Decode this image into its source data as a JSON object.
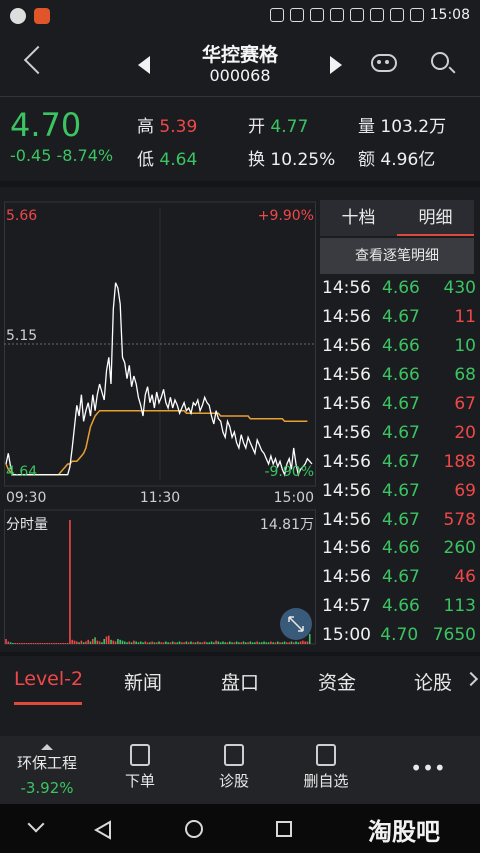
{
  "status_bar": {
    "time": "15:08"
  },
  "header": {
    "title": "华控赛格",
    "code": "000068"
  },
  "quote": {
    "price": "4.70",
    "change": "-0.45",
    "change_pct": "-8.74%",
    "high_label": "高",
    "high": "5.39",
    "low_label": "低",
    "low": "4.64",
    "open_label": "开",
    "open": "4.77",
    "turnover_label": "换",
    "turnover": "10.25%",
    "volume_label": "量",
    "volume": "103.2万",
    "amount_label": "额",
    "amount": "4.96亿"
  },
  "chart_data": {
    "type": "line",
    "y_top_label": "5.66",
    "y_mid_label": "5.15",
    "y_bottom_label": "4.64",
    "pct_top_label": "+9.90%",
    "pct_bottom_label": "-9.90%",
    "x_labels": [
      "09:30",
      "11:30",
      "15:00"
    ],
    "volume_label": "分时量",
    "volume_max_label": "14.81万",
    "ylim": [
      4.64,
      5.66
    ],
    "price_series": [
      4.7,
      4.74,
      4.69,
      4.66,
      4.66,
      4.66,
      4.66,
      4.66,
      4.66,
      4.66,
      4.66,
      4.66,
      4.66,
      4.66,
      4.66,
      4.66,
      4.66,
      4.66,
      4.66,
      4.66,
      4.66,
      4.66,
      4.66,
      4.66,
      4.66,
      4.66,
      4.66,
      4.66,
      4.69,
      4.76,
      4.84,
      4.92,
      4.88,
      4.96,
      4.86,
      4.9,
      4.93,
      4.88,
      4.96,
      4.9,
      4.96,
      5.0,
      4.97,
      4.94,
      5.05,
      5.1,
      5.0,
      5.28,
      5.38,
      5.36,
      5.3,
      5.1,
      5.08,
      5.02,
      5.07,
      4.99,
      5.03,
      5.0,
      4.95,
      4.92,
      4.88,
      4.96,
      4.99,
      4.93,
      4.96,
      4.91,
      4.97,
      4.93,
      4.95,
      4.98,
      4.93,
      4.91,
      4.95,
      4.91,
      4.94,
      4.92,
      4.89,
      4.91,
      4.93,
      4.9,
      4.91,
      4.89,
      4.93,
      4.92,
      4.94,
      4.9,
      4.92,
      4.95,
      4.93,
      4.92,
      4.88,
      4.85,
      4.9,
      4.87,
      4.86,
      4.82,
      4.8,
      4.86,
      4.84,
      4.8,
      4.82,
      4.78,
      4.76,
      4.81,
      4.78,
      4.76,
      4.8,
      4.78,
      4.76,
      4.74,
      4.79,
      4.77,
      4.75,
      4.74,
      4.72,
      4.7,
      4.73,
      4.7,
      4.72,
      4.69,
      4.71,
      4.68,
      4.66,
      4.7,
      4.72,
      4.68,
      4.76,
      4.7,
      4.66,
      4.68,
      4.69,
      4.7,
      4.72,
      4.71,
      4.7
    ],
    "avg_series": [
      4.7,
      4.68,
      4.67,
      4.66,
      4.66,
      4.66,
      4.66,
      4.66,
      4.66,
      4.66,
      4.66,
      4.66,
      4.66,
      4.66,
      4.66,
      4.66,
      4.66,
      4.66,
      4.66,
      4.66,
      4.66,
      4.66,
      4.66,
      4.66,
      4.67,
      4.68,
      4.69,
      4.7,
      4.7,
      4.71,
      4.71,
      4.71,
      4.72,
      4.73,
      4.74,
      4.76,
      4.8,
      4.84,
      4.86,
      4.88,
      4.89,
      4.9,
      4.9,
      4.9,
      4.9,
      4.9,
      4.9,
      4.9,
      4.9,
      4.9,
      4.9,
      4.9,
      4.9,
      4.9,
      4.9,
      4.9,
      4.9,
      4.9,
      4.9,
      4.9,
      4.9,
      4.9,
      4.9,
      4.9,
      4.9,
      4.9,
      4.9,
      4.9,
      4.9,
      4.9,
      4.9,
      4.9,
      4.9,
      4.9,
      4.9,
      4.9,
      4.9,
      4.9,
      4.9,
      4.89,
      4.89,
      4.89,
      4.89,
      4.89,
      4.89,
      4.89,
      4.89,
      4.89,
      4.89,
      4.89,
      4.89,
      4.89,
      4.89,
      4.89,
      4.88,
      4.88,
      4.88,
      4.88,
      4.88,
      4.88,
      4.88,
      4.88,
      4.88,
      4.88,
      4.88,
      4.88,
      4.88,
      4.87,
      4.87,
      4.87,
      4.87,
      4.87,
      4.87,
      4.87,
      4.87,
      4.87,
      4.87,
      4.87,
      4.87,
      4.87,
      4.87,
      4.87,
      4.86,
      4.86,
      4.86,
      4.86,
      4.86,
      4.86,
      4.86,
      4.86,
      4.86,
      4.86,
      4.86
    ],
    "volume_series": [
      0.6,
      0.3,
      0.2,
      0.1,
      0.1,
      0.05,
      0.05,
      0.05,
      0.05,
      0.05,
      0.05,
      0.05,
      0.05,
      0.05,
      0.05,
      0.05,
      0.05,
      0.05,
      0.05,
      0.05,
      0.05,
      0.05,
      0.05,
      0.05,
      0.05,
      0.05,
      0.05,
      0.05,
      14.81,
      0.5,
      0.4,
      0.3,
      0.2,
      0.4,
      0.2,
      0.3,
      0.5,
      0.3,
      0.6,
      0.8,
      0.4,
      0.3,
      0.2,
      0.6,
      0.9,
      1.0,
      0.5,
      0.4,
      0.3,
      0.6,
      0.5,
      0.4,
      0.3,
      0.2,
      0.3,
      0.2,
      0.4,
      0.3,
      0.2,
      0.3,
      0.2,
      0.3,
      0.2,
      0.2,
      0.3,
      0.2,
      0.2,
      0.3,
      0.2,
      0.2,
      0.3,
      0.2,
      0.2,
      0.3,
      0.2,
      0.2,
      0.3,
      0.2,
      0.2,
      0.3,
      0.2,
      0.3,
      0.2,
      0.2,
      0.3,
      0.2,
      0.2,
      0.3,
      0.2,
      0.2,
      0.3,
      0.2,
      0.4,
      0.3,
      0.2,
      0.3,
      0.2,
      0.2,
      0.3,
      0.2,
      0.2,
      0.3,
      0.2,
      0.2,
      0.3,
      0.2,
      0.2,
      0.3,
      0.2,
      0.2,
      0.3,
      0.2,
      0.2,
      0.3,
      0.2,
      0.2,
      0.3,
      0.2,
      0.2,
      0.3,
      0.2,
      0.2,
      0.3,
      0.2,
      0.2,
      0.3,
      0.2,
      0.3,
      0.2,
      0.3,
      0.4,
      0.3,
      0.3,
      1.2
    ]
  },
  "detail_tabs": {
    "tab1": "十档",
    "tab2": "明细",
    "view_all": "查看逐笔明细"
  },
  "ticks": [
    {
      "time": "14:56",
      "price": "4.66",
      "vol": "430",
      "dir": "buy"
    },
    {
      "time": "14:56",
      "price": "4.67",
      "vol": "11",
      "dir": "sell"
    },
    {
      "time": "14:56",
      "price": "4.66",
      "vol": "10",
      "dir": "buy"
    },
    {
      "time": "14:56",
      "price": "4.66",
      "vol": "68",
      "dir": "buy"
    },
    {
      "time": "14:56",
      "price": "4.67",
      "vol": "67",
      "dir": "sell"
    },
    {
      "time": "14:56",
      "price": "4.67",
      "vol": "20",
      "dir": "sell"
    },
    {
      "time": "14:56",
      "price": "4.67",
      "vol": "188",
      "dir": "sell"
    },
    {
      "time": "14:56",
      "price": "4.67",
      "vol": "69",
      "dir": "sell"
    },
    {
      "time": "14:56",
      "price": "4.67",
      "vol": "578",
      "dir": "sell"
    },
    {
      "time": "14:56",
      "price": "4.66",
      "vol": "260",
      "dir": "buy"
    },
    {
      "time": "14:56",
      "price": "4.67",
      "vol": "46",
      "dir": "sell"
    },
    {
      "time": "14:57",
      "price": "4.66",
      "vol": "113",
      "dir": "buy"
    },
    {
      "time": "15:00",
      "price": "4.70",
      "vol": "7650",
      "dir": "buy"
    }
  ],
  "bottom_tabs": [
    "Level-2",
    "新闻",
    "盘口",
    "资金",
    "论股"
  ],
  "toolbar": {
    "sector_name": "环保工程",
    "sector_pct": "-3.92%",
    "order": "下单",
    "diagnose": "诊股",
    "remove_fav": "删自选"
  },
  "watermark": "淘股吧",
  "colors": {
    "up": "#f04848",
    "down": "#3bc461",
    "avg": "#e8a030",
    "price_line": "#ffffff"
  }
}
